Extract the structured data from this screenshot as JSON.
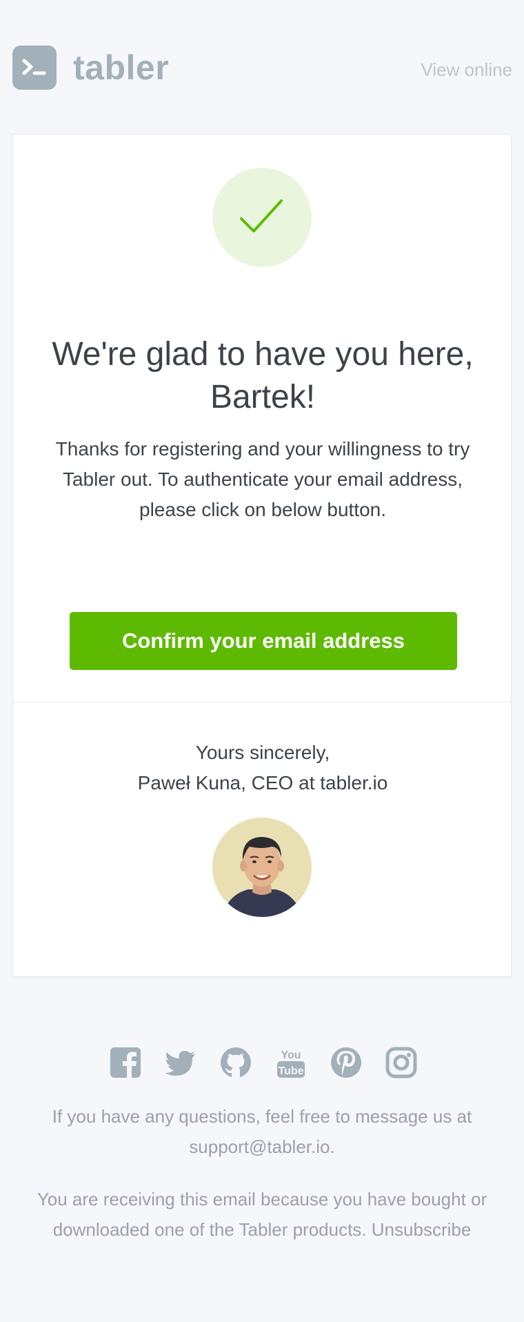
{
  "header": {
    "brand": "tabler",
    "view_online": "View online"
  },
  "card": {
    "title_line1": "We're glad to have you here,",
    "title_line2": "Bartek!",
    "lead": "Thanks for registering and your willingness to try Tabler out. To authenticate your email address, please click on below button.",
    "button_label": "Confirm your email address",
    "closing": "Yours sincerely,",
    "signature": "Paweł Kuna, CEO at tabler.io"
  },
  "footer": {
    "questions_text": "If you have any questions, feel free to message us at",
    "support_email": "support@tabler.io",
    "support_suffix": ".",
    "receiving_text": "You are receiving this email because you have bought or downloaded one of the Tabler products.",
    "unsubscribe": "Unsubscribe",
    "social": [
      "facebook-icon",
      "twitter-icon",
      "github-icon",
      "youtube-icon",
      "pinterest-icon",
      "instagram-icon"
    ],
    "youtube_you": "You",
    "youtube_tube": "Tube"
  },
  "colors": {
    "background": "#f5f7fb",
    "accent_green": "#5eba00",
    "logo_gray": "#a2b0b9",
    "muted_text": "#9aa0ac"
  }
}
